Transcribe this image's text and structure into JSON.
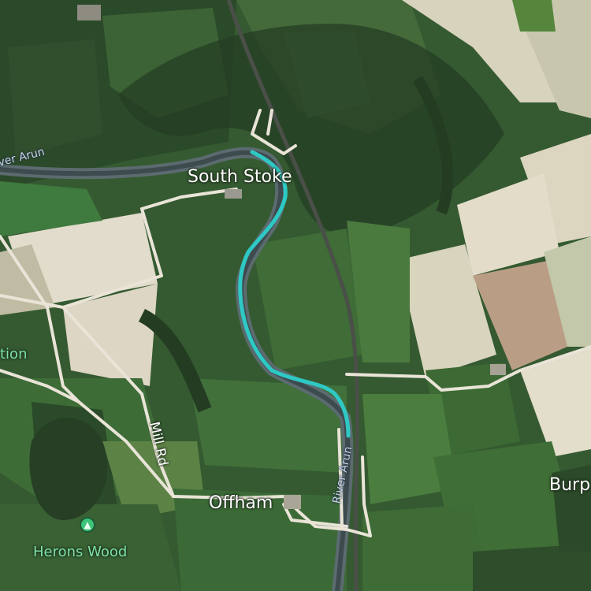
{
  "map": {
    "route_color": "#2ec9c4",
    "labels": {
      "south_stoke": "South Stoke",
      "offham": "Offham",
      "burpham_partial": "Burp",
      "river_arun_top": "ver Arun",
      "river_arun_lower": "River Arun",
      "station_partial": "tion",
      "mill_rd": "Mill Rd",
      "herons_wood": "Herons Wood"
    },
    "poi": {
      "herons_wood_icon": "tree-icon"
    }
  }
}
